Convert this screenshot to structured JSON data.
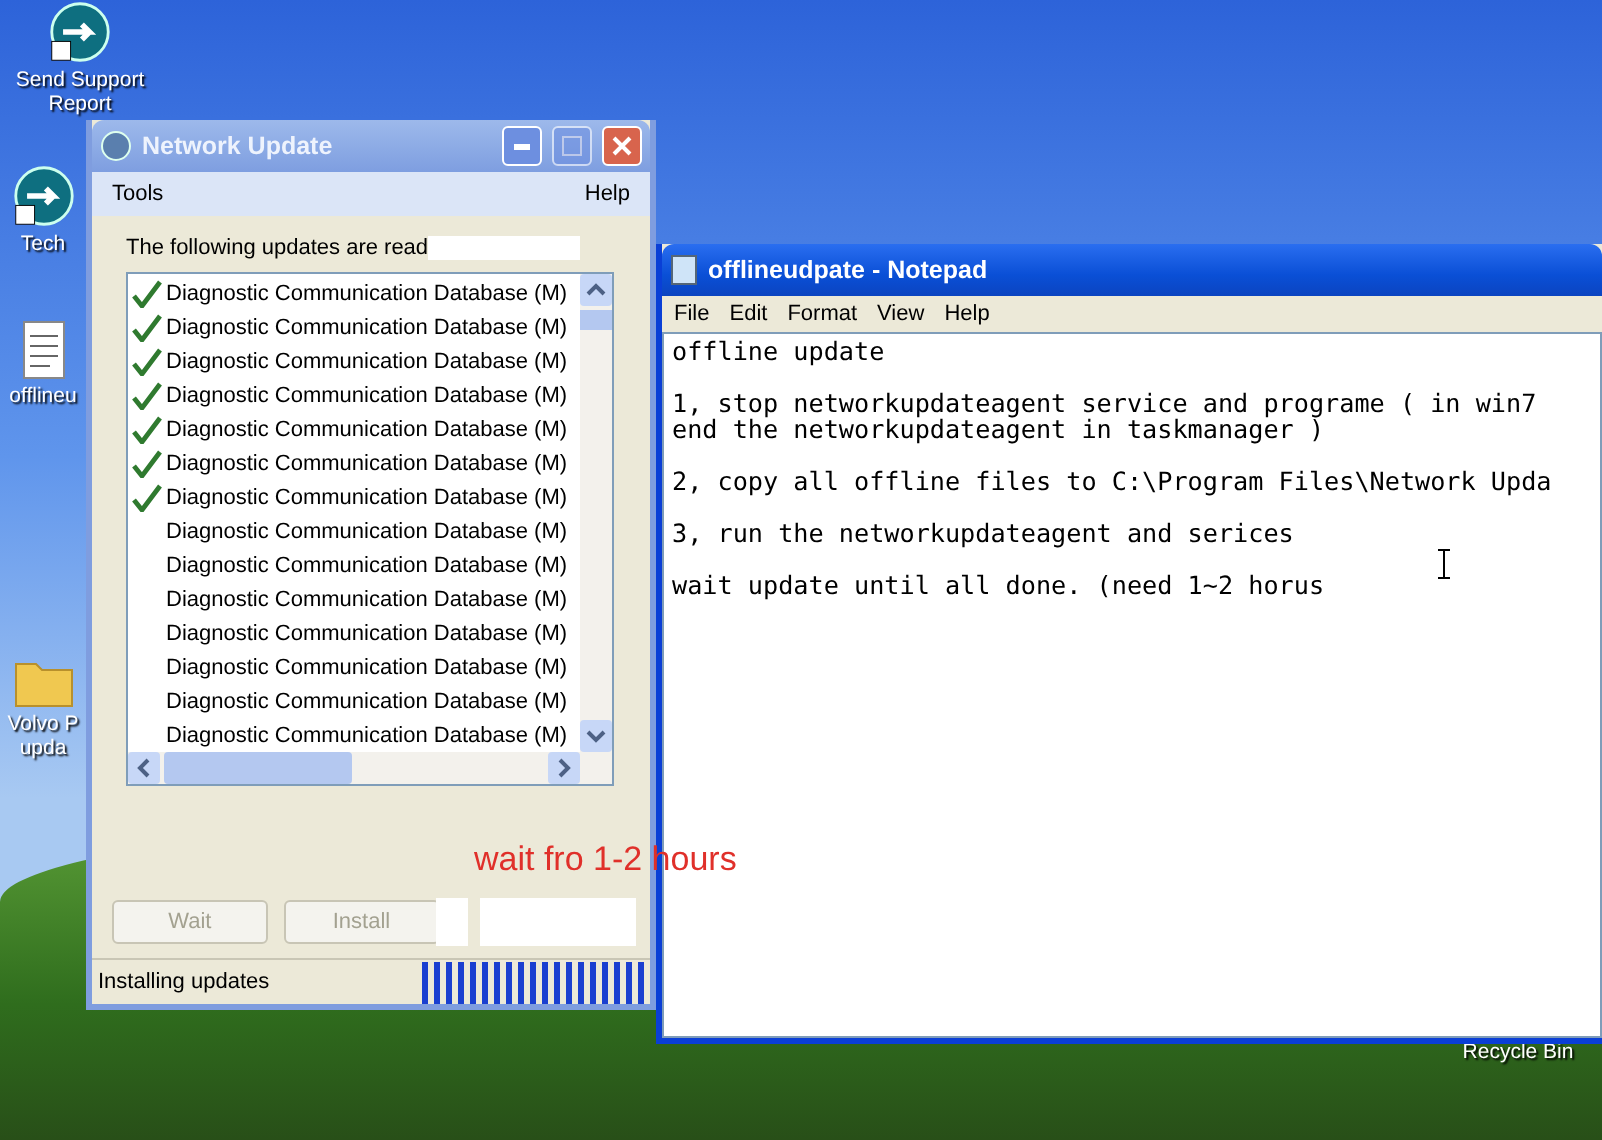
{
  "desktop_icons": [
    {
      "label": "Send Support Report",
      "kind": "shortcut"
    },
    {
      "label": "Tech",
      "kind": "shortcut"
    },
    {
      "label": "offlineu",
      "kind": "document"
    },
    {
      "label": "Volvo P upda",
      "kind": "folder"
    },
    {
      "label": "Recycle Bin",
      "kind": "bin"
    }
  ],
  "update_window": {
    "title": "Network Update",
    "active": false,
    "menu": [
      "Tools",
      "Help"
    ],
    "intro": "The following updates are read",
    "items": [
      {
        "label": "Diagnostic Communication Database (M)",
        "checked": true
      },
      {
        "label": "Diagnostic Communication Database (M)",
        "checked": true
      },
      {
        "label": "Diagnostic Communication Database (M)",
        "checked": true
      },
      {
        "label": "Diagnostic Communication Database (M)",
        "checked": true
      },
      {
        "label": "Diagnostic Communication Database (M)",
        "checked": true
      },
      {
        "label": "Diagnostic Communication Database (M)",
        "checked": true
      },
      {
        "label": "Diagnostic Communication Database (M)",
        "checked": true
      },
      {
        "label": "Diagnostic Communication Database (M)",
        "checked": false
      },
      {
        "label": "Diagnostic Communication Database (M)",
        "checked": false
      },
      {
        "label": "Diagnostic Communication Database (M)",
        "checked": false
      },
      {
        "label": "Diagnostic Communication Database (M)",
        "checked": false
      },
      {
        "label": "Diagnostic Communication Database (M)",
        "checked": false
      },
      {
        "label": "Diagnostic Communication Database (M)",
        "checked": false
      },
      {
        "label": "Diagnostic Communication Database (M)",
        "checked": false
      }
    ],
    "buttons": [
      {
        "label": "Wait",
        "disabled": true
      },
      {
        "label": "Install",
        "disabled": true
      }
    ],
    "status": "Installing updates"
  },
  "annotation": "wait fro 1-2 hours",
  "notepad": {
    "title": "offlineudpate - Notepad",
    "active": true,
    "menu": [
      "File",
      "Edit",
      "Format",
      "View",
      "Help"
    ],
    "paragraphs": [
      [
        "offline update"
      ],
      [
        "1, stop networkupdateagent service and programe ( in win7",
        "end the networkupdateagent in taskmanager )"
      ],
      [
        "2, copy all offline files to C:\\Program Files\\Network Upda"
      ],
      [
        "3, run the networkupdateagent and serices"
      ],
      [
        "wait update until all done. (need 1~2 horus"
      ]
    ]
  }
}
